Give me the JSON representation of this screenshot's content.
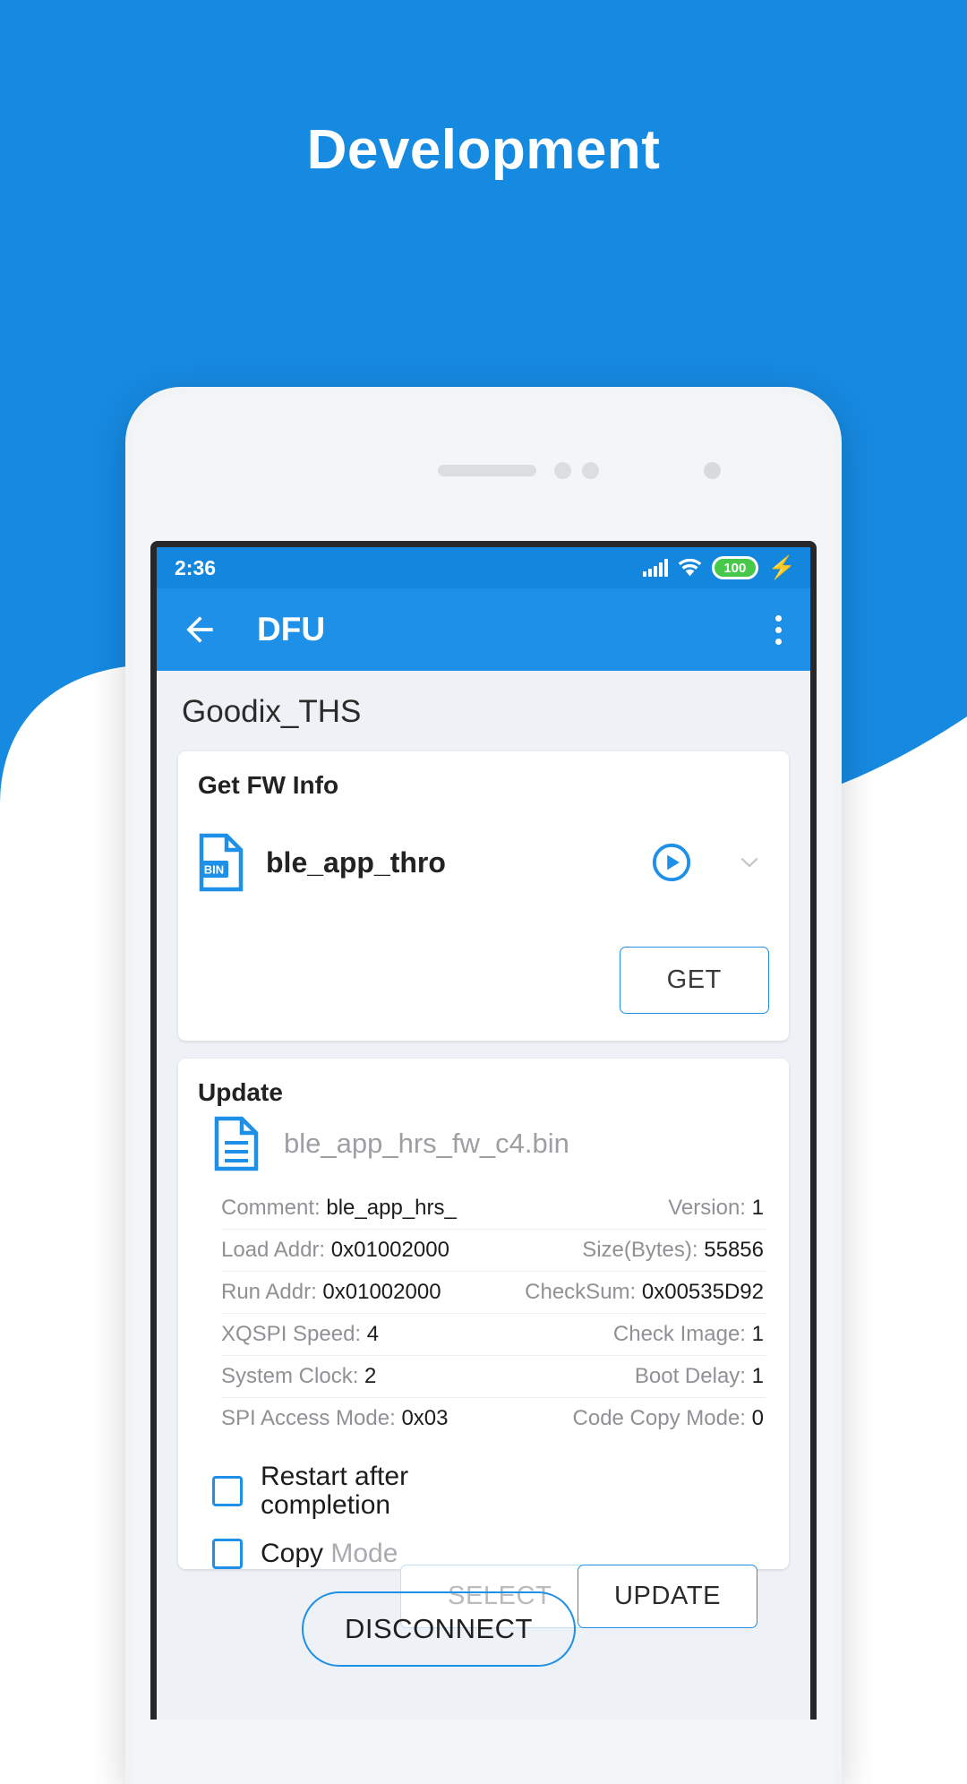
{
  "promo": {
    "title": "Development",
    "bg_color": "#1689e0",
    "wave_color": "#ffffff"
  },
  "status_bar": {
    "time": "2:36",
    "signal_icon": "signal-bars-icon",
    "wifi_icon": "wifi-icon",
    "battery_level": "100",
    "battery_color": "#46c94a",
    "charging_icon": "lightning-bolt-icon"
  },
  "app_bar": {
    "back_icon": "back-arrow-icon",
    "title": "DFU",
    "overflow_icon": "overflow-menu-icon",
    "bg_color": "#1e90e8"
  },
  "device": {
    "name": "Goodix_THS"
  },
  "get_fw_info": {
    "card_title": "Get FW Info",
    "file_icon": "bin-file-icon",
    "file_icon_label": "BIN",
    "file_name": "ble_app_thro",
    "play_icon": "play-circle-icon",
    "expand_icon": "chevron-down-icon",
    "get_button": "GET"
  },
  "update": {
    "card_title": "Update",
    "file_icon": "document-lines-icon",
    "file_name": "ble_app_hrs_fw_c4.bin",
    "info_rows": [
      {
        "left_key": "Comment:",
        "left_value": "ble_app_hrs_",
        "right_key": "Version:",
        "right_value": "1"
      },
      {
        "left_key": "Load Addr:",
        "left_value": "0x01002000",
        "right_key": "Size(Bytes):",
        "right_value": "55856"
      },
      {
        "left_key": "Run Addr:",
        "left_value": "0x01002000",
        "right_key": "CheckSum:",
        "right_value": "0x00535D92"
      },
      {
        "left_key": "XQSPI Speed:",
        "left_value": "4",
        "right_key": "Check Image:",
        "right_value": "1"
      },
      {
        "left_key": "System Clock:",
        "left_value": "2",
        "right_key": "Boot Delay:",
        "right_value": "1"
      },
      {
        "left_key": "SPI Access Mode:",
        "left_value": "0x03",
        "right_key": "Code Copy Mode:",
        "right_value": "0"
      }
    ],
    "checkboxes": [
      {
        "label": "Restart after completion",
        "checked": false
      },
      {
        "label": "Copy ",
        "suffix": "Mode",
        "checked": false
      }
    ],
    "buttons": {
      "select": "SELECT",
      "update": "UPDATE",
      "disconnect": "DISCONNECT"
    }
  }
}
